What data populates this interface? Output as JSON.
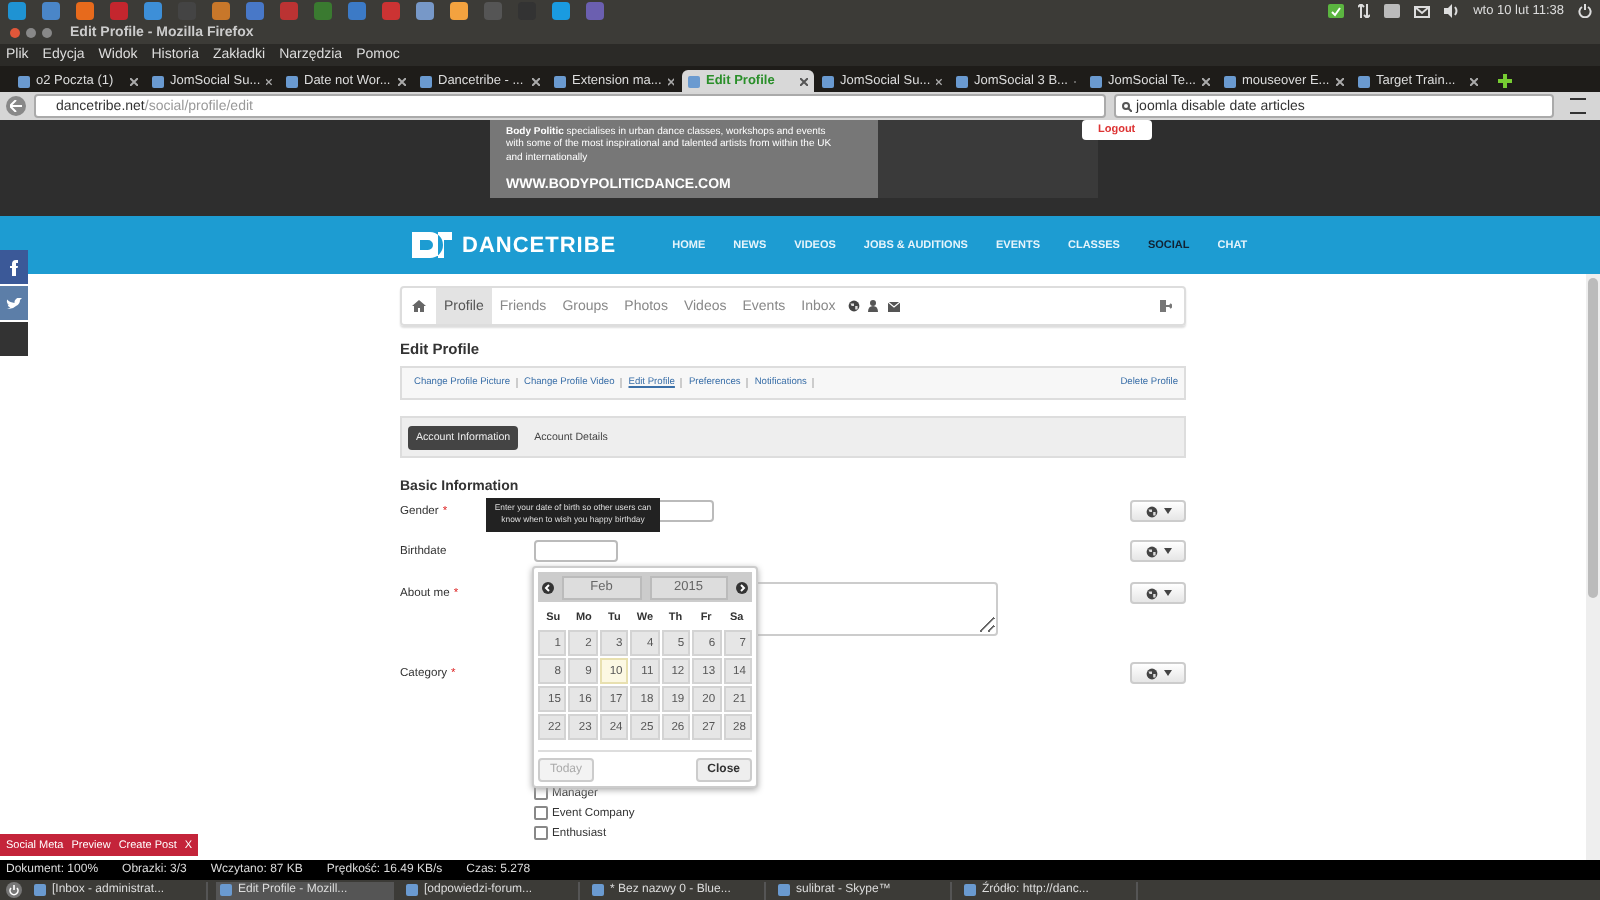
{
  "top_panel": {
    "clock": "wto 10 lut 11:38"
  },
  "window": {
    "title": "Edit Profile - Mozilla Firefox"
  },
  "menu": [
    "Plik",
    "Edycja",
    "Widok",
    "Historia",
    "Zakładki",
    "Narzędzia",
    "Pomoc"
  ],
  "tabs": [
    {
      "label": "o2 Poczta (1)",
      "selected": false
    },
    {
      "label": "JomSocial Su...",
      "selected": false
    },
    {
      "label": "Date not Wor...",
      "selected": false
    },
    {
      "label": "Dancetribe - ...",
      "selected": false
    },
    {
      "label": "Extension ma...",
      "selected": false
    },
    {
      "label": "Edit Profile",
      "selected": true
    },
    {
      "label": "JomSocial Su...",
      "selected": false
    },
    {
      "label": "JomSocial 3 B...",
      "selected": false
    },
    {
      "label": "JomSocial Te...",
      "selected": false
    },
    {
      "label": "mouseover E...",
      "selected": false
    },
    {
      "label": "Target Train...",
      "selected": false
    }
  ],
  "address_bar": {
    "host": "dancetribe.net",
    "path": "/social/profile/edit"
  },
  "search": {
    "value": "joomla disable date articles"
  },
  "ad_banner": {
    "text": "**Body Politic** specialises in urban dance classes, workshops and events with some of the most inspirational and talented artists from within the UK and internationally",
    "url": "WWW.BODYPOLITICDANCE.COM"
  },
  "logout_button": "Logout",
  "site_nav": {
    "logo": "DANCETRIBE",
    "items": [
      {
        "label": "HOME",
        "selected": false
      },
      {
        "label": "NEWS",
        "selected": false
      },
      {
        "label": "VIDEOS",
        "selected": false
      },
      {
        "label": "JOBS & AUDITIONS",
        "selected": false
      },
      {
        "label": "EVENTS",
        "selected": false
      },
      {
        "label": "CLASSES",
        "selected": false
      },
      {
        "label": "SOCIAL",
        "selected": true
      },
      {
        "label": "CHAT",
        "selected": false
      }
    ]
  },
  "profile_nav": [
    {
      "label": "Profile",
      "selected": true
    },
    {
      "label": "Friends",
      "selected": false
    },
    {
      "label": "Groups",
      "selected": false
    },
    {
      "label": "Photos",
      "selected": false
    },
    {
      "label": "Videos",
      "selected": false
    },
    {
      "label": "Events",
      "selected": false
    },
    {
      "label": "Inbox",
      "selected": false
    }
  ],
  "page_title": "Edit Profile",
  "sub_links": [
    {
      "label": "Change Profile Picture",
      "selected": false
    },
    {
      "label": "Change Profile Video",
      "selected": false
    },
    {
      "label": "Edit Profile",
      "selected": true
    },
    {
      "label": "Preferences",
      "selected": false
    },
    {
      "label": "Notifications",
      "selected": false
    }
  ],
  "delete_link": "Delete Profile",
  "section_tabs": [
    {
      "label": "Account Information",
      "selected": true
    },
    {
      "label": "Account Details",
      "selected": false
    }
  ],
  "section_title": "Basic Information",
  "fields": [
    {
      "label": "Gender",
      "marker": "*",
      "kind": "select"
    },
    {
      "label": "Birthdate",
      "kind": "text"
    },
    {
      "label": "About me",
      "marker": "*",
      "kind": "textarea"
    },
    {
      "label": "Category",
      "marker": "*",
      "kind": "checkboxes",
      "options": [
        {
          "label": "Manager",
          "checked": false
        },
        {
          "label": "Event Company",
          "checked": false
        },
        {
          "label": "Enthusiast",
          "checked": false
        }
      ]
    }
  ],
  "tooltip": "Enter your date of birth so other users can know when to wish you happy birthday",
  "datepicker": {
    "month": "Feb",
    "year": "2015",
    "weekdays": [
      "Su",
      "Mo",
      "Tu",
      "We",
      "Th",
      "Fr",
      "Sa"
    ],
    "days": [
      {
        "label": "1",
        "today": false
      },
      {
        "label": "2",
        "today": false
      },
      {
        "label": "3",
        "today": false
      },
      {
        "label": "4",
        "today": false
      },
      {
        "label": "5",
        "today": false
      },
      {
        "label": "6",
        "today": false
      },
      {
        "label": "7",
        "today": false
      },
      {
        "label": "8",
        "today": false
      },
      {
        "label": "9",
        "today": false
      },
      {
        "label": "10",
        "today": true
      },
      {
        "label": "11",
        "today": false
      },
      {
        "label": "12",
        "today": false
      },
      {
        "label": "13",
        "today": false
      },
      {
        "label": "14",
        "today": false
      },
      {
        "label": "15",
        "today": false
      },
      {
        "label": "16",
        "today": false
      },
      {
        "label": "17",
        "today": false
      },
      {
        "label": "18",
        "today": false
      },
      {
        "label": "19",
        "today": false
      },
      {
        "label": "20",
        "today": false
      },
      {
        "label": "21",
        "today": false
      },
      {
        "label": "22",
        "today": false
      },
      {
        "label": "23",
        "today": false
      },
      {
        "label": "24",
        "today": false
      },
      {
        "label": "25",
        "today": false
      },
      {
        "label": "26",
        "today": false
      },
      {
        "label": "27",
        "today": false
      },
      {
        "label": "28",
        "today": false
      }
    ],
    "today_button": {
      "label": "Today",
      "disabled": true
    },
    "close_button": "Close"
  },
  "social_meta_bar": [
    "Social Meta",
    "Preview",
    "Create Post",
    "X"
  ],
  "status_bar": [
    "Dokument: 100%",
    "Obrazki: 3/3",
    "Wczytano: 87 KB",
    "Prędkość: 16.49 KB/s",
    "Czas: 5.278"
  ],
  "taskbar": [
    "[Inbox - administrat...",
    "Edit Profile - Mozill...",
    "[odpowiedzi-forum...",
    "* Bez nazwy 0 - Blue...",
    "sulibrat - Skype™",
    "Źródło: http://danc..."
  ]
}
